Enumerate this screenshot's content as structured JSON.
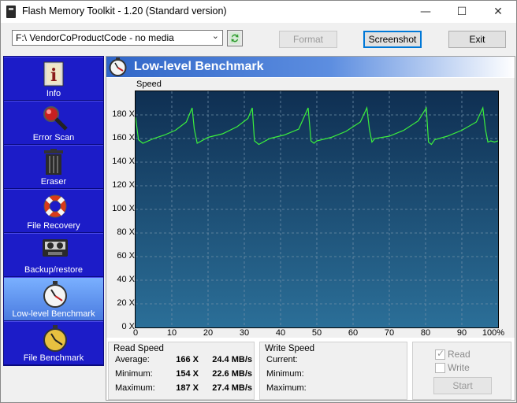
{
  "window": {
    "title": "Flash Memory Toolkit - 1.20 (Standard version)",
    "minimize_glyph": "—",
    "maximize_glyph": "☐",
    "close_glyph": "✕"
  },
  "toolbar": {
    "drive_value": "F:\\ VendorCoProductCode - no media",
    "format_label": "Format",
    "screenshot_label": "Screenshot",
    "exit_label": "Exit"
  },
  "sidebar": {
    "items": [
      {
        "label": "Info",
        "icon": "info-icon"
      },
      {
        "label": "Error Scan",
        "icon": "magnifier-icon"
      },
      {
        "label": "Eraser",
        "icon": "trash-icon"
      },
      {
        "label": "File Recovery",
        "icon": "lifebuoy-icon"
      },
      {
        "label": "Backup/restore",
        "icon": "tape-icon"
      },
      {
        "label": "Low-level Benchmark",
        "icon": "stopwatch-icon",
        "active": true
      },
      {
        "label": "File Benchmark",
        "icon": "stopwatch-icon"
      }
    ]
  },
  "main": {
    "title": "Low-level Benchmark",
    "speed_axis_label": "Speed"
  },
  "chart_data": {
    "type": "line",
    "xlabel": "",
    "ylabel": "Speed",
    "x_ticks": [
      "0",
      "10",
      "20",
      "30",
      "40",
      "50",
      "60",
      "70",
      "80",
      "90",
      "100%"
    ],
    "y_ticks": [
      "0 X",
      "20 X",
      "40 X",
      "60 X",
      "80 X",
      "100 X",
      "120 X",
      "140 X",
      "160 X",
      "180 X"
    ],
    "xlim": [
      0,
      100
    ],
    "ylim": [
      0,
      200
    ],
    "grid": true,
    "series": [
      {
        "color": "#3cf03c",
        "x": [
          0,
          0.8,
          2,
          5,
          8,
          11,
          14,
          15.6,
          16.2,
          17,
          20,
          24,
          28,
          31,
          32.2,
          32.8,
          34,
          37,
          41,
          45,
          47.6,
          48.4,
          49.2,
          50,
          54,
          58,
          62,
          63.8,
          64.5,
          65.2,
          66,
          70,
          74,
          78,
          80.2,
          80.8,
          81.6,
          82.5,
          86,
          90,
          94,
          95.8,
          96.5,
          97.2,
          98,
          99,
          100
        ],
        "y": [
          178,
          159,
          156,
          160,
          163,
          167,
          174,
          186,
          168,
          156,
          161,
          164,
          170,
          177,
          186,
          158,
          155,
          160,
          163,
          168,
          186,
          158,
          156,
          158,
          161,
          166,
          174,
          186,
          168,
          157,
          160,
          162,
          167,
          175,
          186,
          157,
          155,
          159,
          162,
          167,
          174,
          186,
          168,
          157,
          158,
          157,
          158
        ]
      }
    ]
  },
  "read_speed": {
    "title": "Read Speed",
    "rows": [
      {
        "label": "Average:",
        "x": "166 X",
        "mbs": "24.4 MB/s"
      },
      {
        "label": "Minimum:",
        "x": "154 X",
        "mbs": "22.6 MB/s"
      },
      {
        "label": "Maximum:",
        "x": "187 X",
        "mbs": "27.4 MB/s"
      }
    ]
  },
  "write_speed": {
    "title": "Write Speed",
    "rows": [
      {
        "label": "Current:"
      },
      {
        "label": "Minimum:"
      },
      {
        "label": "Maximum:"
      }
    ]
  },
  "options": {
    "read_label": "Read",
    "read_checked": true,
    "write_label": "Write",
    "write_checked": false,
    "start_label": "Start"
  }
}
